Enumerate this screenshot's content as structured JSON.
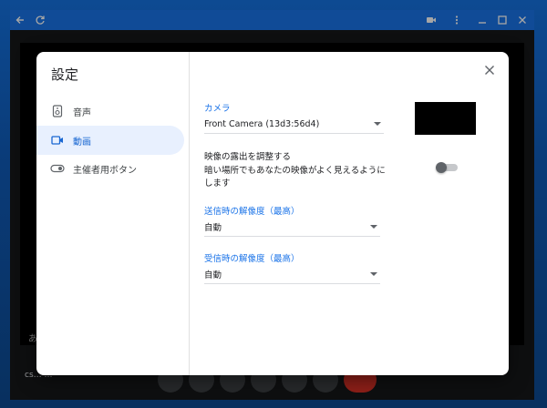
{
  "titlebar": {
    "back_icon": "arrow-back-icon",
    "refresh_icon": "refresh-icon",
    "camera_icon": "videocam-icon",
    "more_icon": "more-vert-icon",
    "minimize_icon": "minimize-icon",
    "maximize_icon": "maximize-icon",
    "close_icon": "close-icon"
  },
  "meeting": {
    "left_caption": "あ",
    "code": "cs… …"
  },
  "dialog": {
    "title": "設定",
    "nav": [
      {
        "label": "音声",
        "icon": "speaker-icon",
        "active": false
      },
      {
        "label": "動画",
        "icon": "videocam-icon",
        "active": true
      },
      {
        "label": "主催者用ボタン",
        "icon": "toggle-icon",
        "active": false
      }
    ],
    "camera": {
      "label": "カメラ",
      "value": "Front Camera (13d3:56d4)"
    },
    "adjust": {
      "title": "映像の露出を調整する",
      "description": "暗い場所でもあなたの映像がよく見えるようにします",
      "enabled": false
    },
    "send_resolution": {
      "label": "送信時の解像度（最高）",
      "value": "自動"
    },
    "receive_resolution": {
      "label": "受信時の解像度（最高）",
      "value": "自動"
    }
  },
  "colors": {
    "accent": "#1a73e8",
    "titlebar": "#1a73e8",
    "active_nav_bg": "#e8f0fe",
    "end_call": "#d93025"
  }
}
